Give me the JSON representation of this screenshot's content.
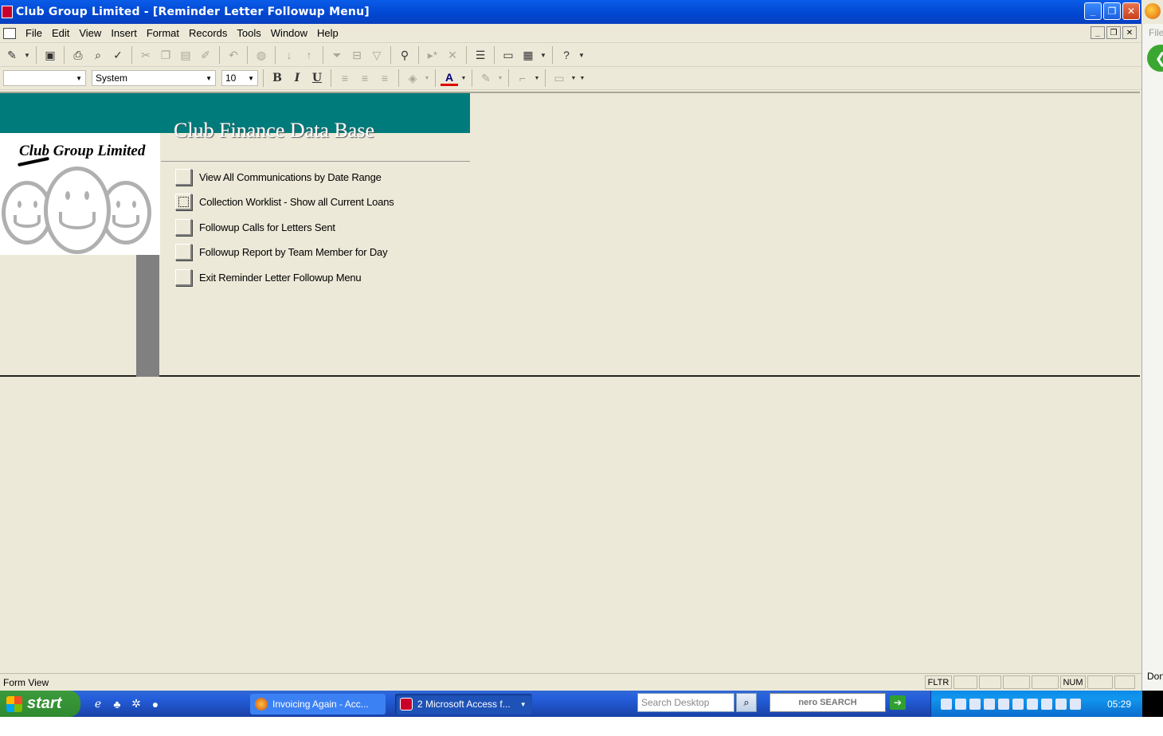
{
  "window": {
    "title": "Club Group Limited - [Reminder Letter Followup Menu]",
    "buttons": [
      "_",
      "❐",
      "✕"
    ]
  },
  "menubar": {
    "items": [
      "File",
      "Edit",
      "View",
      "Insert",
      "Format",
      "Records",
      "Tools",
      "Window",
      "Help"
    ],
    "mdi_buttons": [
      "_",
      "❐",
      "✕"
    ]
  },
  "format_toolbar": {
    "object_value": "",
    "font_value": "System",
    "size_value": "10",
    "bold": "B",
    "italic": "I",
    "underline": "U",
    "font_color_glyph": "A"
  },
  "form": {
    "title": "Club Finance Data Base",
    "logo_text": "Club Group Limited",
    "header_color": "#007b7b",
    "options": [
      {
        "label": "View All Communications by Date Range"
      },
      {
        "label": "Collection Worklist - Show all Current Loans"
      },
      {
        "label": "Followup Calls for Letters Sent"
      },
      {
        "label": "Followup Report by Team Member for Day"
      },
      {
        "label": "Exit Reminder Letter Followup Menu"
      }
    ]
  },
  "statusbar": {
    "text": "Form View",
    "indicators": [
      "FLTR",
      "",
      "",
      "",
      "",
      "NUM",
      "",
      ""
    ]
  },
  "right_panel": {
    "file_label": "File",
    "status_label": "Don"
  },
  "taskbar": {
    "start_label": "start",
    "tasks": [
      {
        "label": "Invoicing Again - Acc..."
      },
      {
        "label": "2 Microsoft Access f..."
      }
    ],
    "search_placeholder": "Search Desktop",
    "nero_label": "nero SEARCH",
    "clock": "05:29"
  }
}
